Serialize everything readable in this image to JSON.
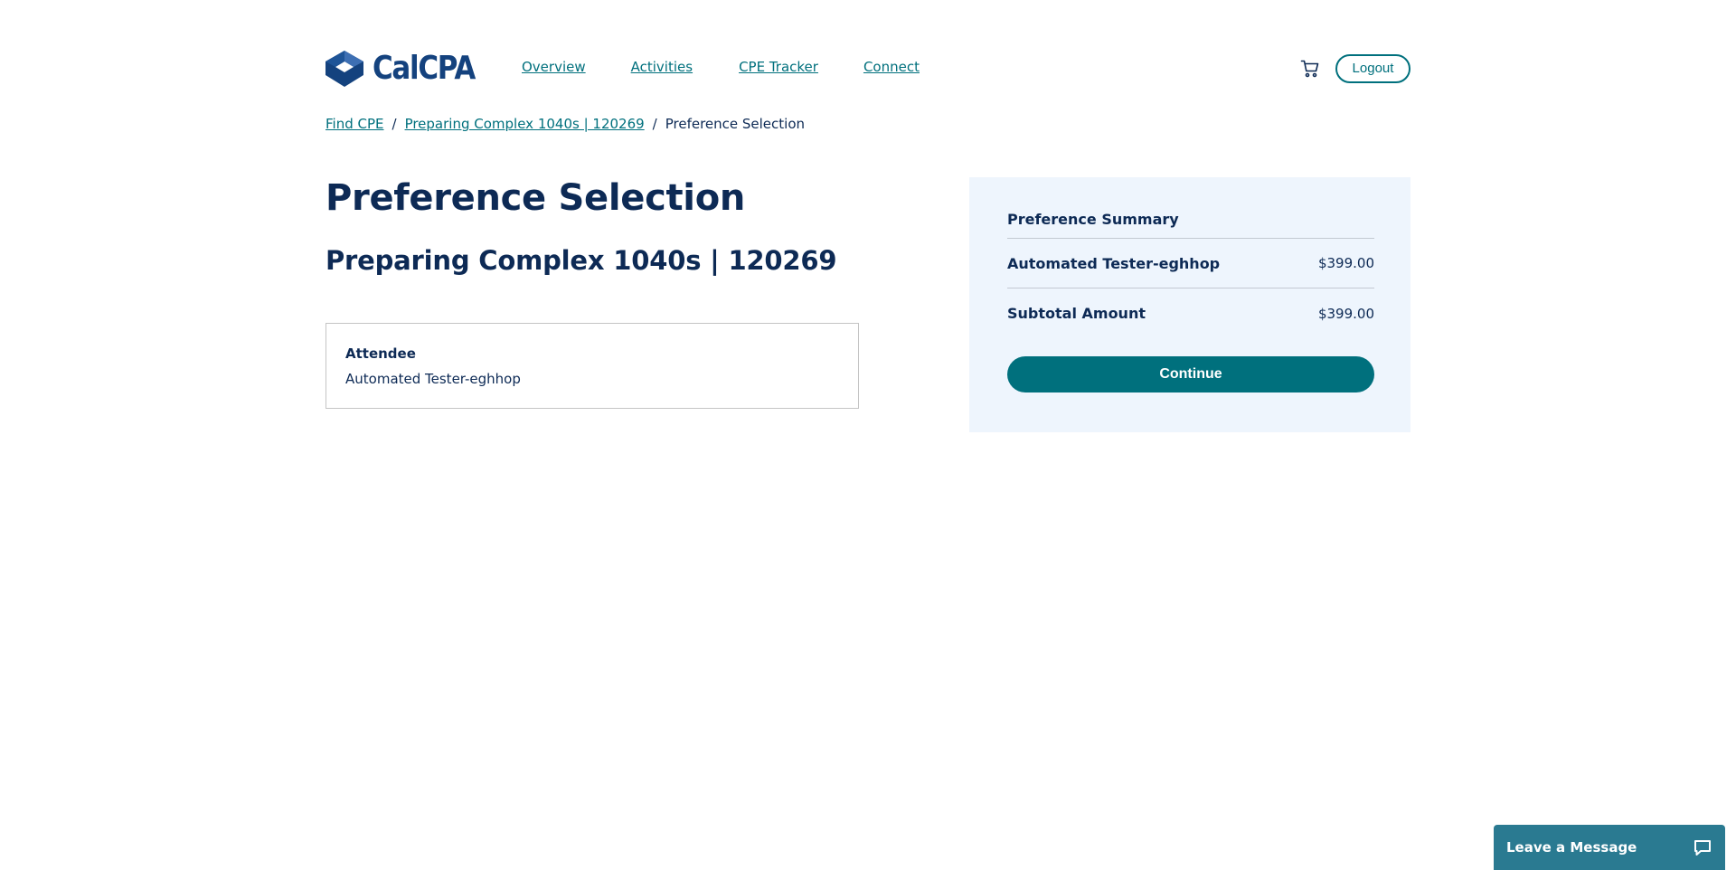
{
  "header": {
    "logo_text": "CalCPA",
    "nav": [
      {
        "label": "Overview"
      },
      {
        "label": "Activities"
      },
      {
        "label": "CPE Tracker"
      },
      {
        "label": "Connect"
      }
    ],
    "cart_icon": "shopping-cart-icon",
    "logout_label": "Logout"
  },
  "breadcrumb": {
    "items": [
      "Find CPE",
      "Preparing Complex 1040s | 120269"
    ],
    "current": "Preference Selection",
    "separator": "/"
  },
  "main": {
    "page_title": "Preference Selection",
    "course_title": "Preparing Complex 1040s | 120269",
    "attendee": {
      "label": "Attendee",
      "name": "Automated Tester-eghhop"
    }
  },
  "summary": {
    "title": "Preference Summary",
    "rows": [
      {
        "label": "Automated Tester-eghhop",
        "amount": "$399.00"
      },
      {
        "label": "Subtotal Amount",
        "amount": "$399.00"
      }
    ],
    "continue_label": "Continue"
  },
  "chat": {
    "label": "Leave a Message",
    "icon": "chat-bubble-icon"
  },
  "colors": {
    "brand_navy": "#0d2a55",
    "logo_blue": "#14427e",
    "accent_teal": "#00707d",
    "summary_bg": "#eef5fd",
    "chat_bg": "#2a7a91"
  }
}
